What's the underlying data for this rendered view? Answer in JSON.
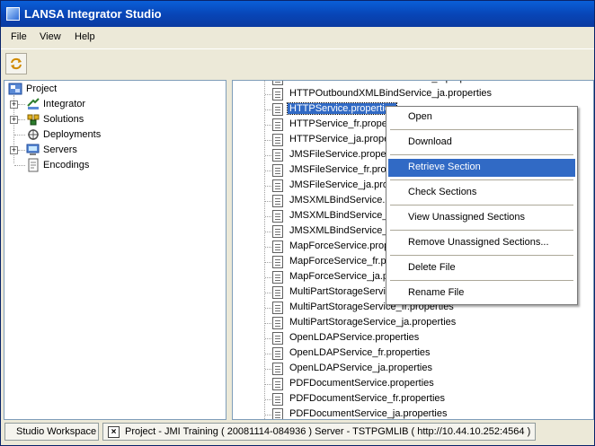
{
  "window": {
    "title": "LANSA Integrator Studio"
  },
  "menubar": {
    "items": [
      "File",
      "View",
      "Help"
    ]
  },
  "toolbar": {
    "button_icon": "refresh-icon"
  },
  "tree": {
    "root": "Project",
    "items": [
      {
        "label": "Integrator",
        "icon": "integrator-icon",
        "expandable": true
      },
      {
        "label": "Solutions",
        "icon": "solutions-icon",
        "expandable": true
      },
      {
        "label": "Deployments",
        "icon": "deployments-icon",
        "expandable": false
      },
      {
        "label": "Servers",
        "icon": "servers-icon",
        "expandable": true
      },
      {
        "label": "Encodings",
        "icon": "encodings-icon",
        "expandable": false
      }
    ]
  },
  "files": [
    "HTTPOutboundXMLBindService_fr.properties",
    "HTTPOutboundXMLBindService_ja.properties",
    "HTTPService.properties",
    "HTTPService_fr.properties",
    "HTTPService_ja.properties",
    "JMSFileService.properties",
    "JMSFileService_fr.properties",
    "JMSFileService_ja.properties",
    "JMSXMLBindService.properties",
    "JMSXMLBindService_fr.properties",
    "JMSXMLBindService_ja.properties",
    "MapForceService.properties",
    "MapForceService_fr.properties",
    "MapForceService_ja.properties",
    "MultiPartStorageService.properties",
    "MultiPartStorageService_fr.properties",
    "MultiPartStorageService_ja.properties",
    "OpenLDAPService.properties",
    "OpenLDAPService_fr.properties",
    "OpenLDAPService_ja.properties",
    "PDFDocumentService.properties",
    "PDFDocumentService_fr.properties",
    "PDFDocumentService_ja.properties"
  ],
  "selected_file_index": 2,
  "context_menu": {
    "items": [
      "Open",
      "Download",
      "Retrieve Section",
      "Check Sections",
      "View Unassigned Sections",
      "Remove Unassigned Sections...",
      "Delete File",
      "Rename File"
    ],
    "highlighted_index": 2
  },
  "statusbar": {
    "tab_label": "Studio Workspace",
    "info": "Project - JMI Training ( 20081114-084936 ) Server - TSTPGMLIB ( http://10.44.10.252:4564 )"
  },
  "colors": {
    "titlebar": "#0846b8",
    "selection": "#316ac5",
    "face": "#ece9d8"
  }
}
